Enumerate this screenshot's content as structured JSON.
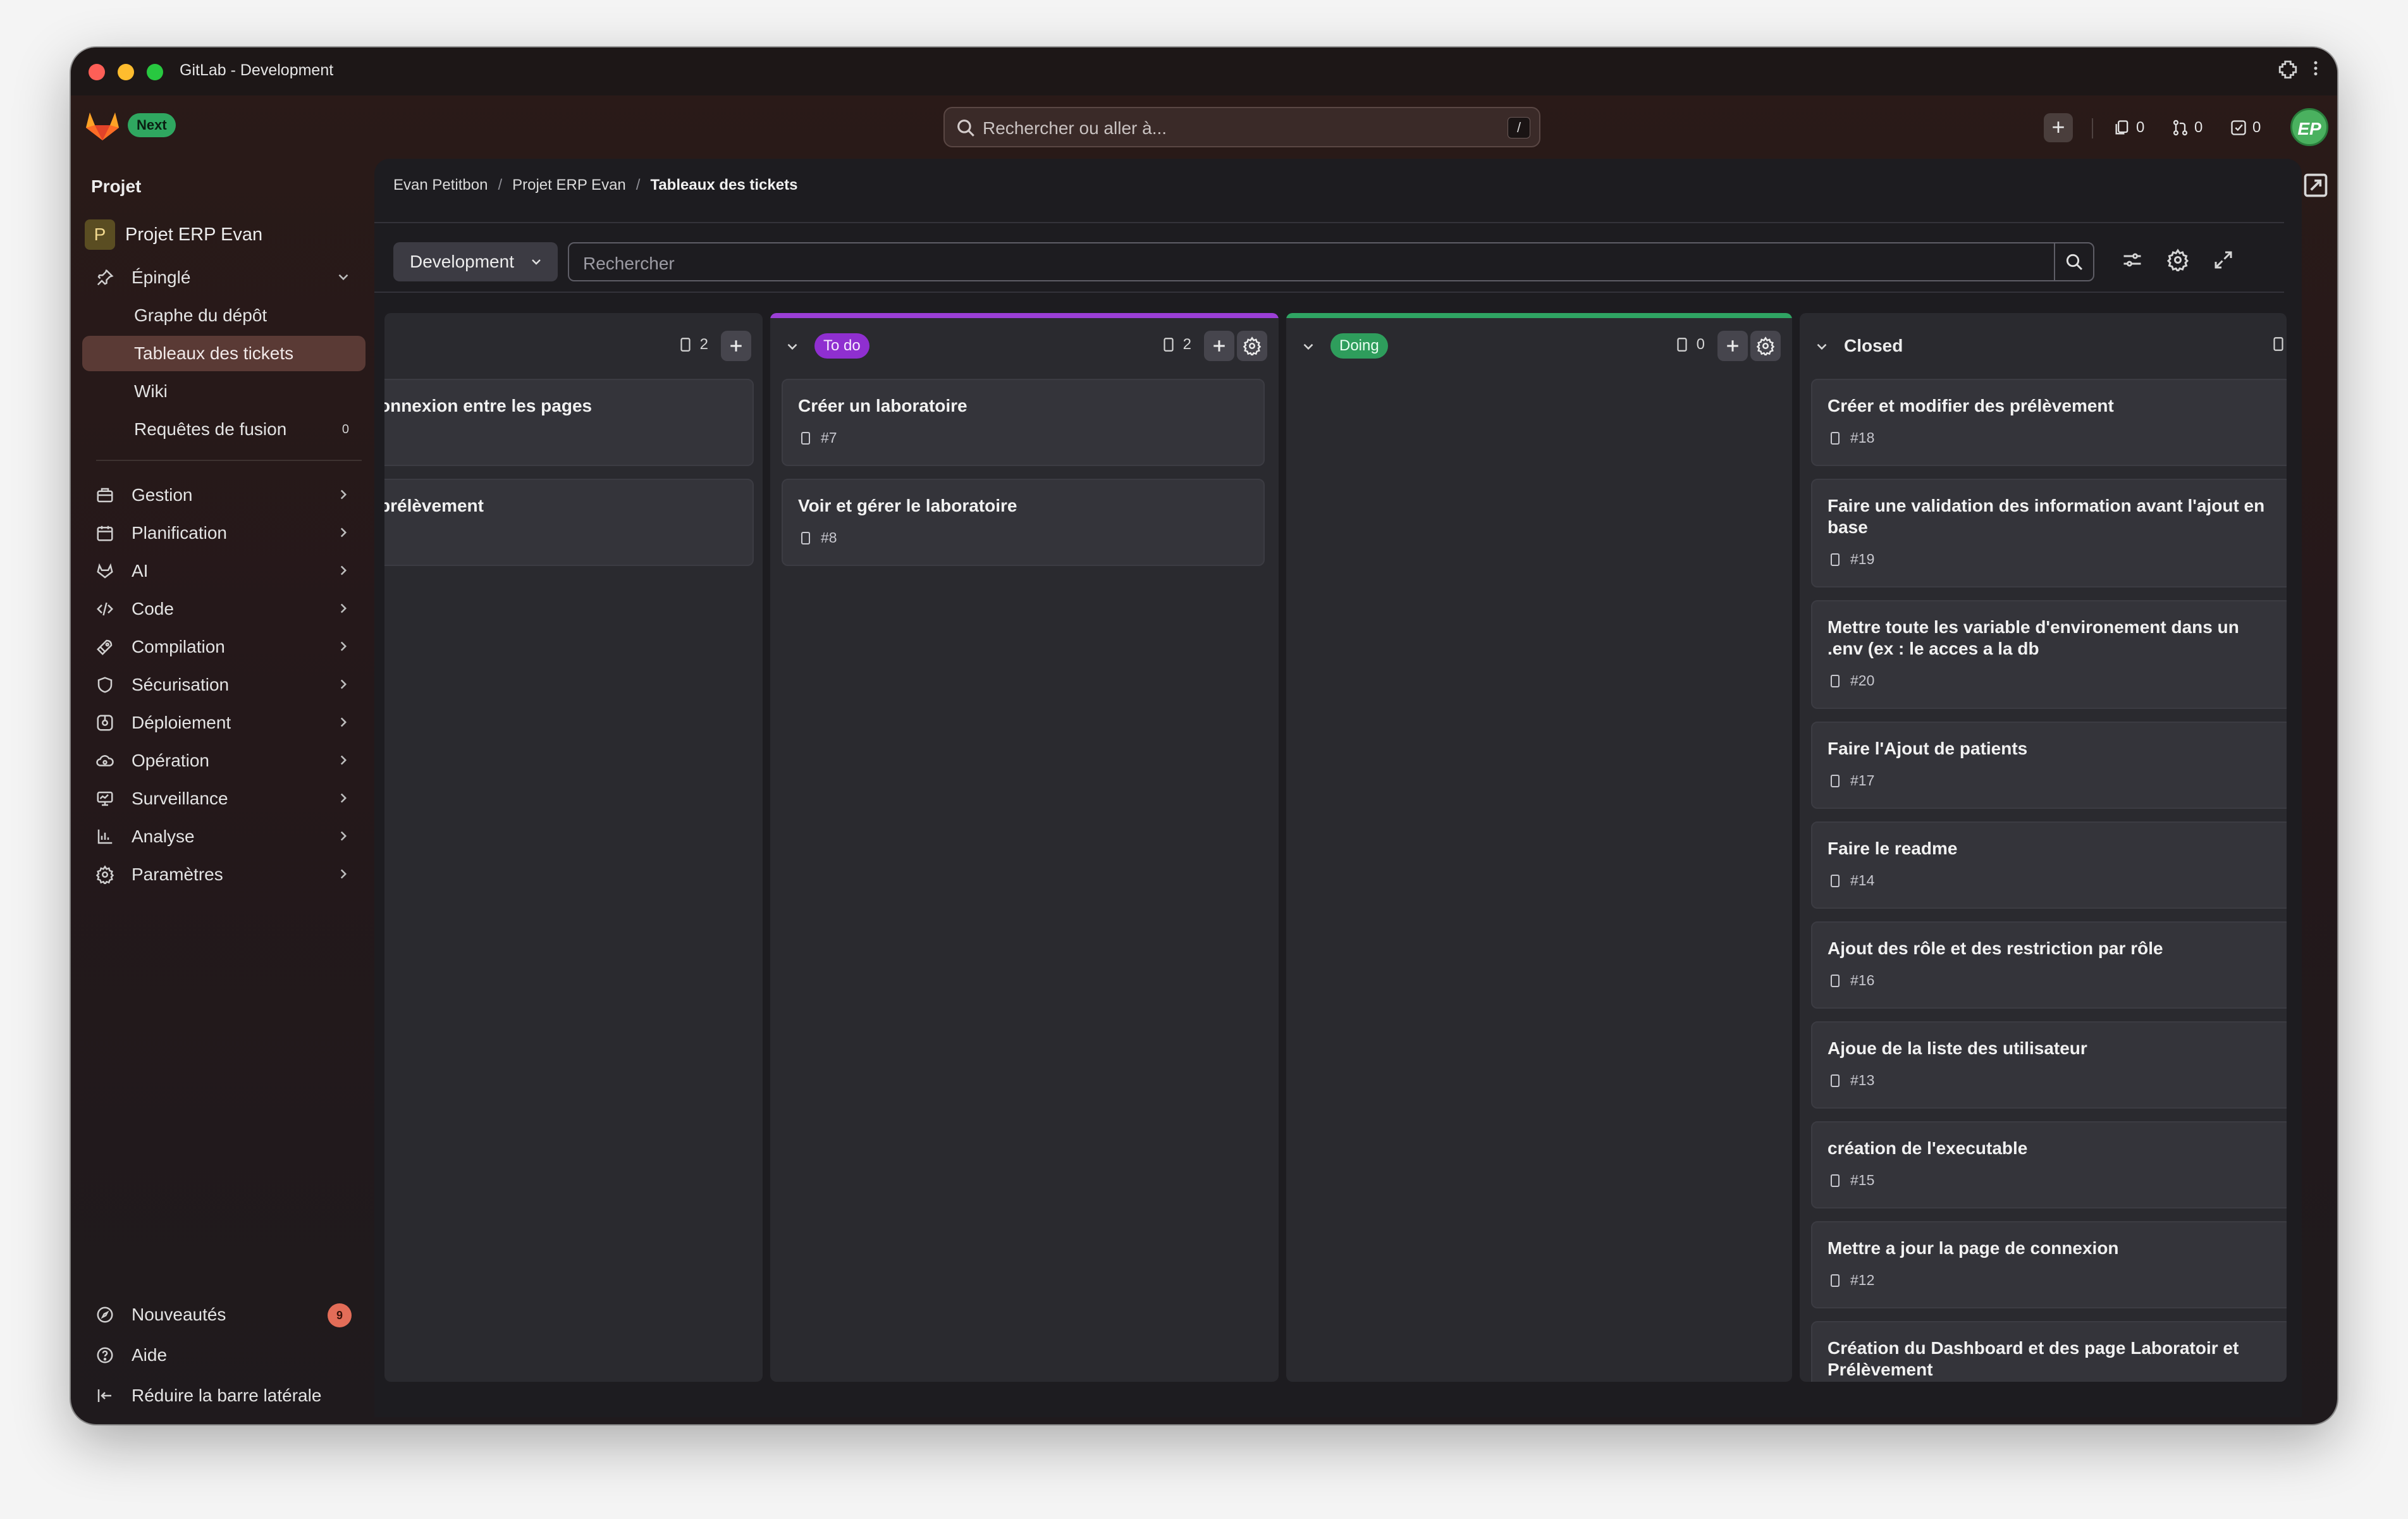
{
  "window": {
    "title": "GitLab - Development"
  },
  "header": {
    "next_badge": "Next",
    "search_placeholder": "Rechercher ou aller à...",
    "search_shortcut": "/",
    "issues_count": "0",
    "merge_requests_count": "0",
    "todos_count": "0",
    "avatar_initials": "EP"
  },
  "sidebar": {
    "heading": "Projet",
    "project_avatar_letter": "P",
    "project_name": "Projet ERP Evan",
    "pinned_label": "Épinglé",
    "pinned_items": [
      {
        "label": "Graphe du dépôt"
      },
      {
        "label": "Tableaux des tickets"
      },
      {
        "label": "Wiki"
      },
      {
        "label": "Requêtes de fusion",
        "count": "0"
      }
    ],
    "sections": [
      {
        "label": "Gestion",
        "icon": "briefcase-icon"
      },
      {
        "label": "Planification",
        "icon": "calendar-icon"
      },
      {
        "label": "AI",
        "icon": "tanuki-ai-icon"
      },
      {
        "label": "Code",
        "icon": "code-icon"
      },
      {
        "label": "Compilation",
        "icon": "rocket-icon"
      },
      {
        "label": "Sécurisation",
        "icon": "shield-icon"
      },
      {
        "label": "Déploiement",
        "icon": "deployments-icon"
      },
      {
        "label": "Opération",
        "icon": "cloud-gear-icon"
      },
      {
        "label": "Surveillance",
        "icon": "monitor-icon"
      },
      {
        "label": "Analyse",
        "icon": "chart-icon"
      },
      {
        "label": "Paramètres",
        "icon": "settings-icon"
      }
    ],
    "footer": {
      "whats_new": "Nouveautés",
      "whats_new_count": "9",
      "help": "Aide",
      "collapse": "Réduire la barre latérale"
    }
  },
  "breadcrumb": {
    "items": [
      "Evan Petitbon",
      "Projet ERP Evan",
      "Tableaux des tickets"
    ],
    "separator": "/"
  },
  "filterbar": {
    "board_name": "Development",
    "search_placeholder": "Rechercher"
  },
  "columns": [
    {
      "label": "",
      "count": "2",
      "cards": [
        {
          "title": "onnexion entre les pages",
          "number": ""
        },
        {
          "title": "prélèvement",
          "number": ""
        }
      ]
    },
    {
      "label": "To do",
      "label_color": "#8f2fd0",
      "count": "2",
      "cards": [
        {
          "title": "Créer un laboratoire",
          "number": "#7"
        },
        {
          "title": "Voir et gérer le laboratoire",
          "number": "#8"
        }
      ]
    },
    {
      "label": "Doing",
      "label_color": "#2e9d5c",
      "count": "0",
      "cards": []
    },
    {
      "label": "Closed",
      "cards": [
        {
          "title": "Créer et modifier des prélèvement",
          "number": "#18"
        },
        {
          "title": "Faire une validation des information avant l'ajout en base",
          "number": "#19"
        },
        {
          "title": "Mettre toute les variable d'environement dans un .env (ex : le acces a la db",
          "number": "#20"
        },
        {
          "title": "Faire l'Ajout de patients",
          "number": "#17"
        },
        {
          "title": "Faire le readme",
          "number": "#14"
        },
        {
          "title": "Ajout des rôle et des restriction par rôle",
          "number": "#16"
        },
        {
          "title": "Ajoue de la liste des utilisateur",
          "number": "#13"
        },
        {
          "title": "création de l'executable",
          "number": "#15"
        },
        {
          "title": "Mettre a jour la page de connexion",
          "number": "#12"
        },
        {
          "title": "Création du Dashboard et des page Laboratoir et Prélèvement",
          "number": ""
        }
      ]
    }
  ],
  "colors": {
    "todo_topline": "#9b3fd6",
    "doing_topline": "#2fa463",
    "todo_label_bg": "#8f2fd0",
    "doing_label_bg": "#2e9d5c",
    "active_nav_bg": "#5a3a35",
    "brand_orange": "#fc6d26"
  }
}
